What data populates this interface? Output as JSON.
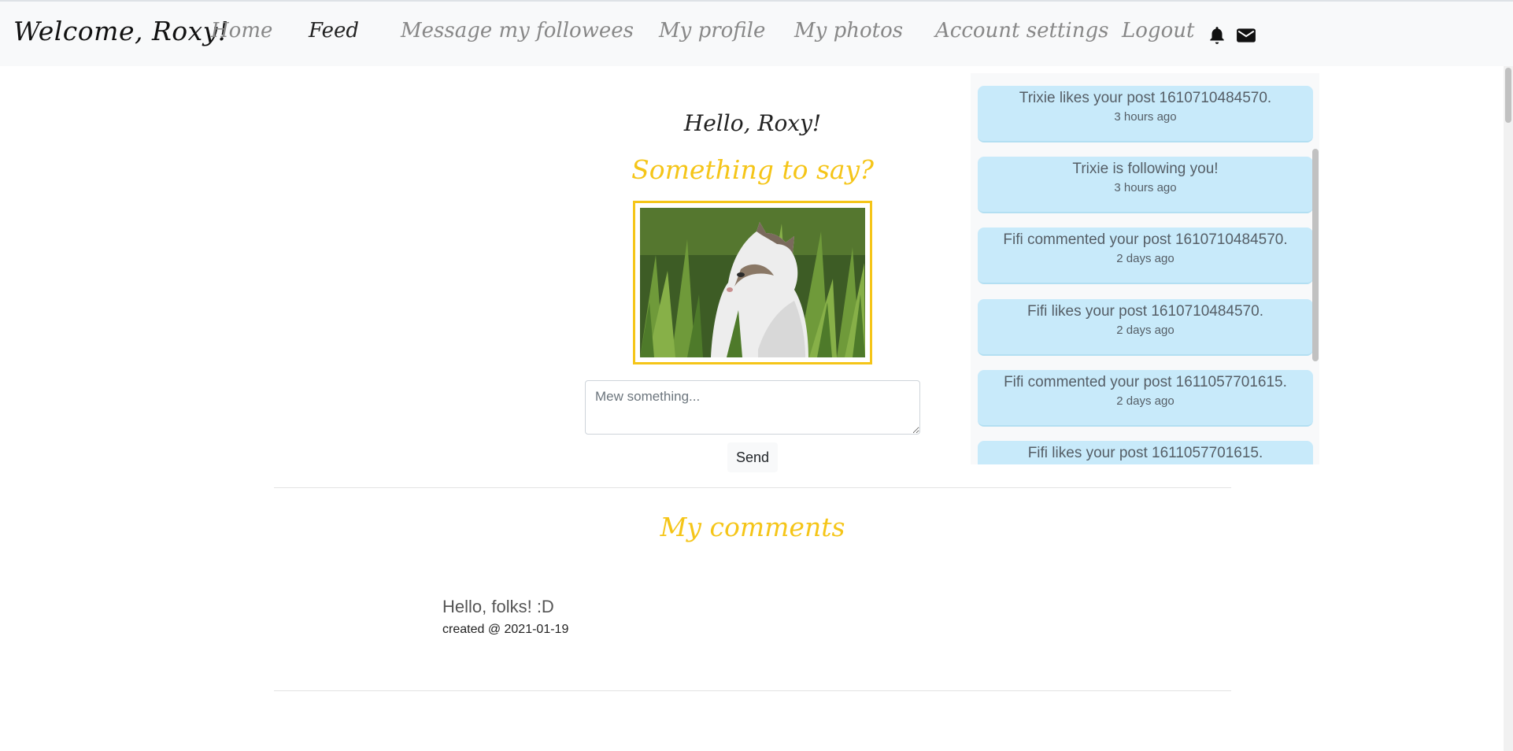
{
  "navbar": {
    "brand": "Welcome, Roxy!",
    "items": [
      {
        "label": "Home"
      },
      {
        "label": "Feed"
      },
      {
        "label": "Message my followees"
      },
      {
        "label": "My profile"
      },
      {
        "label": "My photos"
      },
      {
        "label": "Account settings"
      },
      {
        "label": "Logout"
      }
    ],
    "active_item": "Feed",
    "icons": [
      "bell-icon",
      "envelope-icon"
    ]
  },
  "main": {
    "greeting": "Hello, Roxy!",
    "prompt": "Something to say?",
    "photo": "cat-in-grass",
    "input": {
      "placeholder": "Mew something...",
      "value": ""
    },
    "send_label": "Send"
  },
  "notifications": [
    {
      "text": "Trixie likes your post 1610710484570.",
      "time": "3 hours ago"
    },
    {
      "text": "Trixie is following you!",
      "time": "3 hours ago"
    },
    {
      "text": "Fifi commented your post 1610710484570.",
      "time": "2 days ago"
    },
    {
      "text": "Fifi likes your post 1610710484570.",
      "time": "2 days ago"
    },
    {
      "text": "Fifi commented your post 1611057701615.",
      "time": "2 days ago"
    },
    {
      "text": "Fifi likes your post 1611057701615.",
      "time": ""
    }
  ],
  "comments_section": {
    "title": "My comments",
    "comments": [
      {
        "text": "Hello, folks! :D",
        "created": "created @ 2021-01-19"
      }
    ]
  },
  "colors": {
    "accent": "#f5c518",
    "notification_bg": "#c8eafa",
    "navbar_bg": "#f8f9fa"
  }
}
